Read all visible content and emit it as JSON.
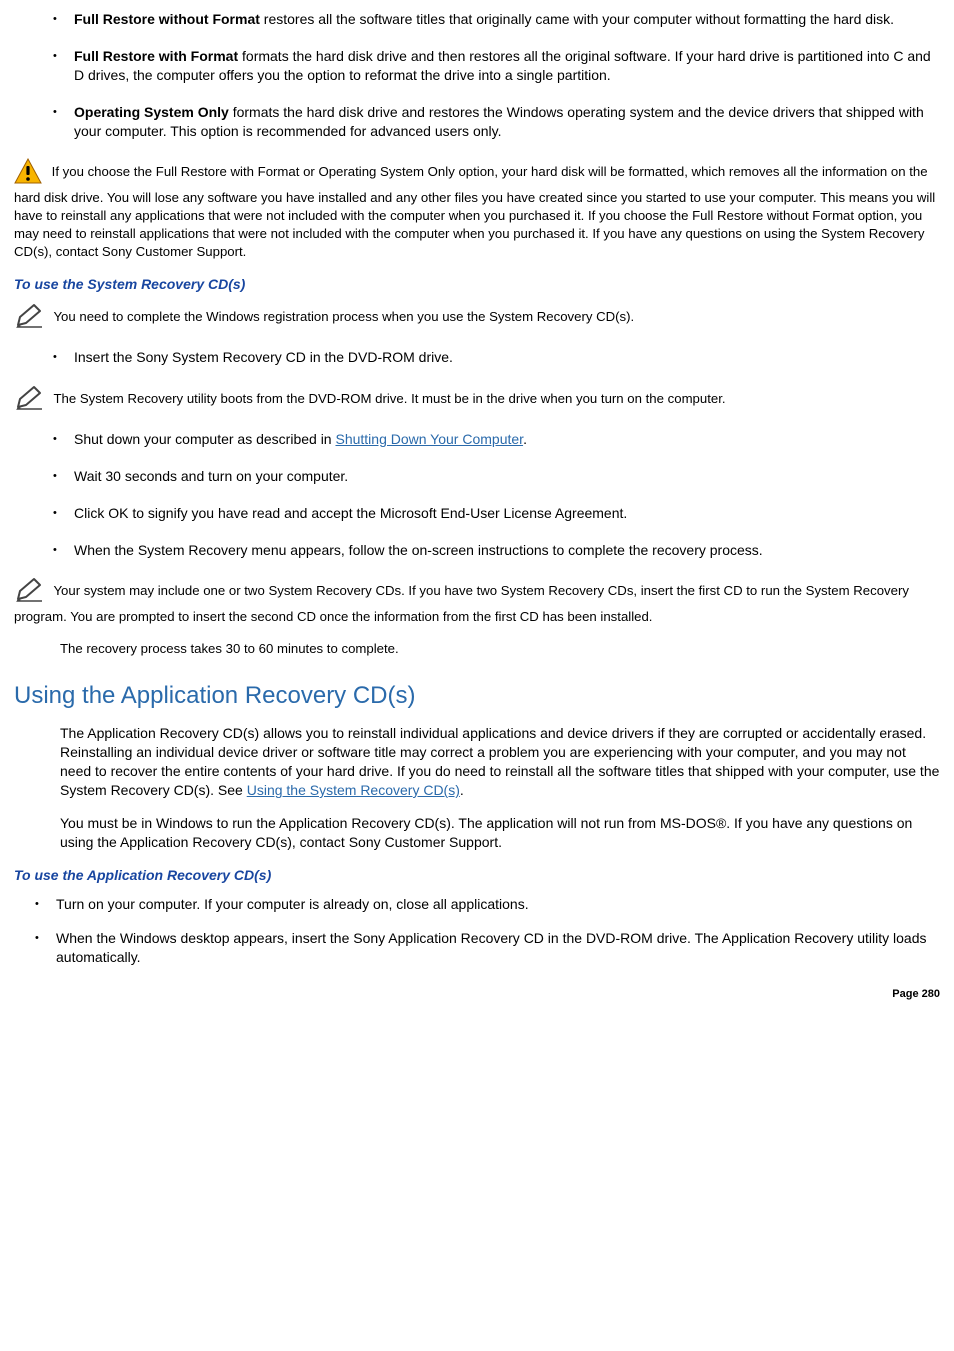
{
  "options": [
    {
      "title": "Full Restore without Format",
      "desc": " restores all the software titles that originally came with your computer without formatting the hard disk."
    },
    {
      "title": "Full Restore with Format",
      "desc": " formats the hard disk drive and then restores all the original software. If your hard drive is partitioned into C and D drives, the computer offers you the option to reformat the drive into a single partition."
    },
    {
      "title": "Operating System Only",
      "desc": " formats the hard disk drive and restores the Windows operating system and the device drivers that shipped with your computer. This option is recommended for advanced users only."
    }
  ],
  "warning": "If you choose the Full Restore with Format or Operating System Only option, your hard disk will be formatted, which removes all the information on the hard disk drive. You will lose any software you have installed and any other files you have created since you started to use your computer. This means you will have to reinstall any applications that were not included with the computer when you purchased it. If you choose the Full Restore without Format option, you may need to reinstall applications that were not included with the computer when you purchased it. If you have any questions on using the System Recovery CD(s), contact Sony Customer Support.",
  "sub1": "To use the System Recovery CD(s)",
  "note1": "You need to complete the Windows registration process when you use the System Recovery CD(s).",
  "step_insert": "Insert the Sony System Recovery CD in the DVD-ROM drive.",
  "note2": "The System Recovery utility boots from the DVD-ROM drive. It must be in the drive when you turn on the computer.",
  "steps2": {
    "shut_pre": "Shut down your computer as described in ",
    "shut_link": "Shutting Down Your Computer",
    "shut_post": ".",
    "wait": "Wait 30 seconds and turn on your computer.",
    "click_ok": "Click OK to signify you have read and accept the Microsoft End-User License Agreement.",
    "menu": "When the System Recovery menu appears, follow the on-screen instructions to complete the recovery process."
  },
  "note3": "Your system may include one or two System Recovery CDs. If you have two System Recovery CDs, insert the first CD to run the System Recovery program. You are prompted to insert the second CD once the information from the first CD has been installed.",
  "recovery_time": "The recovery process takes 30 to 60 minutes to complete.",
  "h2_app": "Using the Application Recovery CD(s)",
  "app_p1_pre": "The Application Recovery CD(s) allows you to reinstall individual applications and device drivers if they are corrupted or accidentally erased. Reinstalling an individual device driver or software title may correct a problem you are experiencing with your computer, and you may not need to recover the entire contents of your hard drive. If you do need to reinstall all the software titles that shipped with your computer, use the System Recovery CD(s). See ",
  "app_p1_link": "Using the System Recovery CD(s)",
  "app_p1_post": ".",
  "app_p2": "You must be in Windows to run the Application Recovery CD(s). The application will not run from MS-DOS®. If you have any questions on using the Application Recovery CD(s), contact Sony Customer Support.",
  "sub2": "To use the Application Recovery CD(s)",
  "app_steps": [
    "Turn on your computer. If your computer is already on, close all applications.",
    "When the Windows desktop appears, insert the Sony Application Recovery CD in the DVD-ROM drive. The Application Recovery utility loads automatically."
  ],
  "page": "Page 280"
}
